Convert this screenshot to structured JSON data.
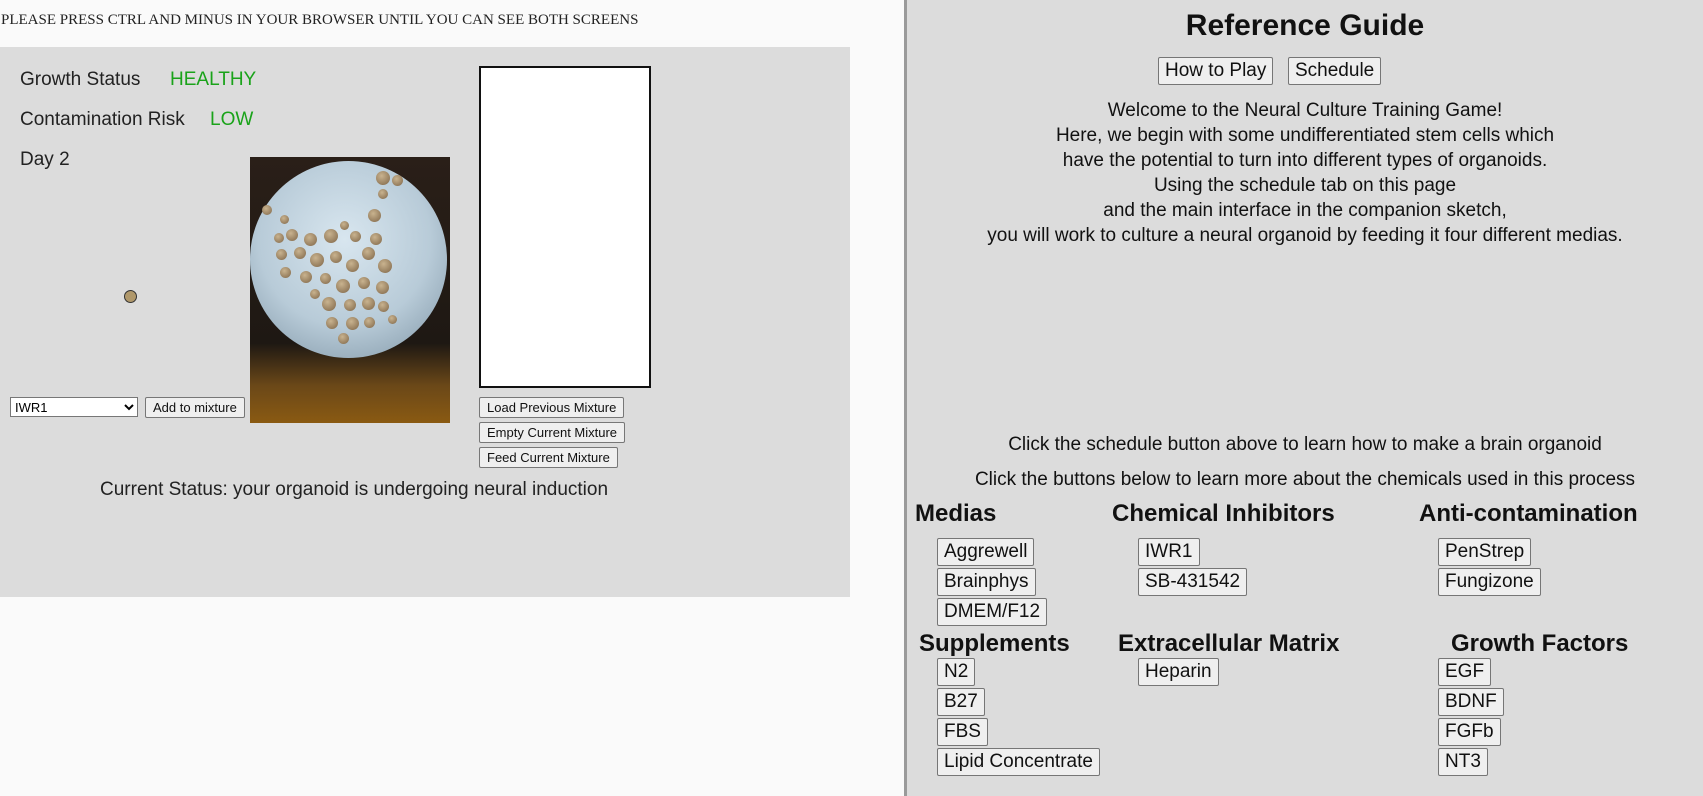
{
  "notice": "PLEASE PRESS CTRL AND MINUS IN YOUR BROWSER UNTIL YOU CAN SEE BOTH SCREENS",
  "game": {
    "growth_label": "Growth Status",
    "growth_value": "HEALTHY",
    "contamination_label": "Contamination Risk",
    "contamination_value": "LOW",
    "day_label": "Day 2",
    "chemical_select": {
      "selected": "IWR1"
    },
    "add_button": "Add to mixture",
    "load_button": "Load Previous Mixture",
    "empty_button": "Empty Current Mixture",
    "feed_button": "Feed Current Mixture",
    "current_status": "Current Status: your organoid is undergoing neural induction",
    "status_color": "#1aa31a"
  },
  "reference": {
    "title": "Reference Guide",
    "tabs": [
      "How to Play",
      "Schedule"
    ],
    "intro_lines": [
      "Welcome to the Neural Culture Training Game!",
      "Here, we begin with some undifferentiated stem cells which",
      "have the potential to turn into different types of organoids.",
      "Using the schedule tab on this page",
      "and the main interface in the companion sketch,",
      "you will work to culture a neural organoid by feeding it four different medias."
    ],
    "schedule_hint": "Click the schedule button above to learn how to make a brain organoid",
    "chemicals_hint": "Click the buttons below to learn more about the chemicals used in this process",
    "categories": [
      {
        "title": "Medias",
        "items": [
          "Aggrewell",
          "Brainphys",
          "DMEM/F12"
        ]
      },
      {
        "title": "Chemical Inhibitors",
        "items": [
          "IWR1",
          "SB-431542"
        ]
      },
      {
        "title": "Anti-contamination",
        "items": [
          "PenStrep",
          "Fungizone"
        ]
      },
      {
        "title": "Supplements",
        "items": [
          "N2",
          "B27",
          "FBS",
          "Lipid Concentrate"
        ]
      },
      {
        "title": "Extracellular Matrix",
        "items": [
          "Heparin"
        ]
      },
      {
        "title": "Growth Factors",
        "items": [
          "EGF",
          "BDNF",
          "FGFb",
          "NT3"
        ]
      }
    ]
  }
}
